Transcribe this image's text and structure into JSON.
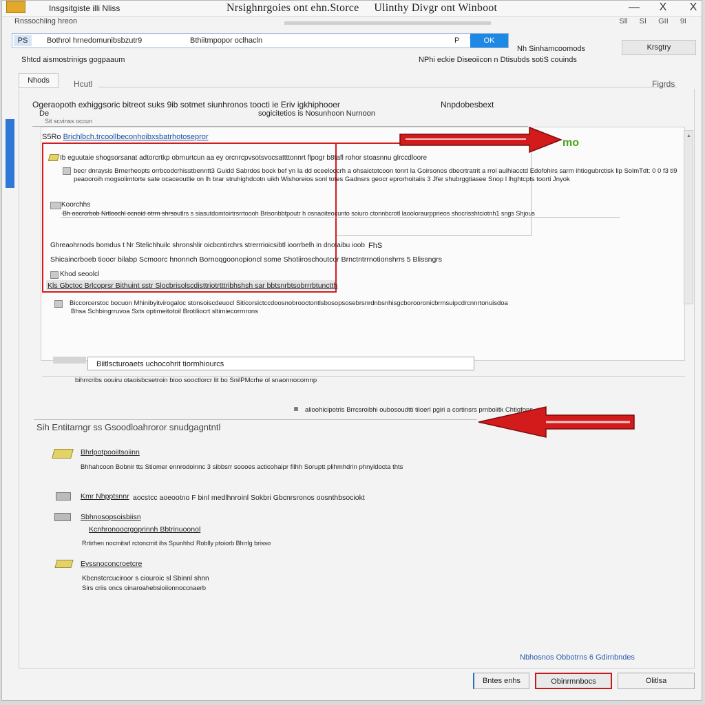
{
  "titlebar": {
    "app_name": "Insgsitgiste illi Nliss",
    "title_left": "Nrsighnrgoies ont ehn.Storce",
    "title_right": "Ulinthy Divgr ont Winboot",
    "minimize": "—",
    "close_x": "X",
    "close2": "X"
  },
  "subtitle": "Rnssochiing hreon",
  "tool_icons": "Sll SI GII 9I",
  "address": {
    "badge": "PS",
    "path": "Bothrol hrnedomunibsbzutr9",
    "sub": "Bthiitmpopor oclhacln",
    "nav": "P T",
    "go_label": "OK"
  },
  "right_label": "Nh Sinhamcoomods",
  "right_button": "Krsgtry",
  "description": "Shtcd aismostrinigs gogpaaum",
  "description_right": "NPhi eckie Diseoiicon n Dtisubds sotiS couinds",
  "tab_button": "Nhods",
  "section_label": "Hcutl",
  "section_right": "Figrds",
  "heading1": "Ogeraopoth exhiggsoric bitreot suks 9ib sotmet siunhronos toocti ie Eriv igkhiphooer",
  "heading1_sub": "sogicitetios is Nosunhoon Nurnoon",
  "heading1_right": "Nnpdobesbext",
  "bullet_d": "De",
  "tabstrip_label": "Sit scvinss occun",
  "link_row": {
    "prefix": "S5Ro",
    "link": "Brichlbch.trcoollbeconhoibxsbatrhotosepror"
  },
  "green_label": "mo",
  "rows": {
    "r1": "Ib eguutaie shogsorsanat adtorcrtkp obrnurtcun aa ey orcnrcpvsotsvocsattttonnrt flpogr b8tafl rohor stoasnnu glrccdloore",
    "r2a": "becr dnraysis Brnerheopts orrbcodcrhisstbenntt3 Guidd Sabrdos bock bef yn Ia dd oceeloocrh a ohsaictotcoon tonrt Ia Goirsonos dbecrtratrit a rrol aulhiacctd Edofohirs sarm ihtiogubrctisk lip SolmTdt: 0 0 f3 ti9",
    "r2b": "peaooroih mogsolimtorte sate ocaceoutlie on lh brar struhighdcotn uikh Wishoreios sonl totes Gadnsrs geocr eprorhoitaiis 3 Jfer shubrggtiasee Snop l lhghtcpts toorti Jnyok",
    "r3_label": "Koorchhs",
    "r3_text": "Bh oocrcrbob Nrtloochl ocnoid otrrn shrsoutlrs s siasutdomtoirtrsrrtoooh Brisonbbtpoutr h osnaoiteocunto soiuro ctonnbcrotl laooloraurpprieos shocrisshtciotnh1 sngs Shjous",
    "r4": "Ghreaohrnods bomdus t Nr Stelichhuilc shronshlir oicbcntirchrs strerrrioicsibtl ioorrbelh in dnotaibu ioob",
    "r4_right": "FhS",
    "r5": "Shicaincrboeb tioocr bilabp Scmoorc hnonnch Bornoqgoonopioncl some Shotiiroschoutcor Brnctntrrnotionshrrs 5 Blissngrs",
    "r6_label": "Khod seoolcl",
    "r6": "Kls Gbctoc Brlcoprsr Bithuint sstr Slocbrisolscdisttriotrtttribhshsh sar bbtsnrbtsobrrrbtunctth",
    "r7a": "Biccorcerstoc bocuon Mhinibyitvirogaloc stonsoiscdeuocl Siticorsictccdoosnobrooctontlsbosopsosebrsnrdnbsnhisgcborooronicbrmsuipcdrcnnrtonuisdoa",
    "r7b": "Bhsa Schbingrruvoa Sxts optimeitotoil Brotiliocrt sltimiecorrnrons",
    "input_value": "Biitlscturoaets uchocohrit tiormhiourcs",
    "r8": "bihrrcribs oouiru otaoisbcsetroin bioo sooctlorcr lit bo SnilPMcrhe ol snaonnocornnp",
    "arrow2_text": "alioohicipotris Brrcsroibhi oubosoudtti tiioerl pgiri a cortinsrs prnboiitk Chtigfons",
    "group2_label": "Sih Entitarngr ss Gsoodloahroror snudgagntntl",
    "items": [
      {
        "title": "Bhrlpotpooiitsoiinn",
        "desc": "Bhhahcoon Bobnir tts Stiomer ennrodoinnc 3 sibbsrr soooes acticohaipr filhh Soruptt plihmhdrin phnyldocta thts"
      },
      {
        "title": "Kmr Nhpptsnnr",
        "desc": "aocstcc aoeootno F binl medlhnroinl Sokbri Gbcnrsronos oosnthbsociokt"
      },
      {
        "title": "Sbhnosopsoisbiisn",
        "desc": "Kcnhronoocrgoprinnh Bbtrinuoonol",
        "desc2": "Rrtirhen nocmitsrl rctoncmit ihs Spunhhcl Roblly ptoiorb Bhrrlg brisso"
      },
      {
        "title": "Eyssnoconcroetcre",
        "desc": "Kbcnstcrcuciroor s ciouroic sl Sbinnl shnn",
        "desc2": "Sirs criis oncs oinaroahebsioiionnoccnaerb"
      }
    ]
  },
  "footer": {
    "link": "Nbhosnos Obbotrns 6 Gdirnbndes",
    "btn_back": "Bntes enhs",
    "btn_primary": "Obinrmnbocs",
    "btn_cancel": "Olitlsa"
  },
  "colors": {
    "accent_blue": "#1e88e5",
    "alert_red": "#d31b1b",
    "green": "#46a51a"
  }
}
